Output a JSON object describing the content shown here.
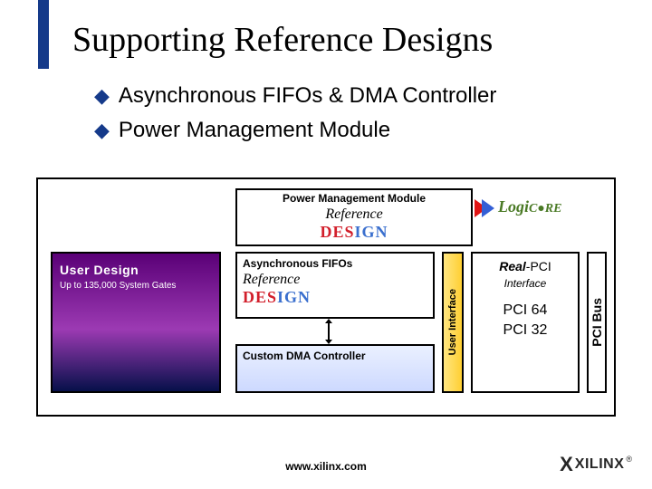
{
  "title": "Supporting Reference Designs",
  "bullets": {
    "b1": "Asynchronous FIFOs & DMA Controller",
    "b2": "Power Management Module"
  },
  "diagram": {
    "user_design": {
      "title": "User Design",
      "sub": "Up to 135,000 System Gates"
    },
    "pm_module": {
      "label": "Power Management Module"
    },
    "refdesign": {
      "line1": "Reference",
      "line2a": "DES",
      "line2b": "IGN"
    },
    "async": {
      "label": "Asynchronous FIFOs"
    },
    "custom_dma": {
      "label": "Custom DMA Controller"
    },
    "user_interface": {
      "label": "User Interface"
    },
    "real_pci": {
      "title_italic": "Real",
      "title_rest": "-PCI",
      "sub": "Interface",
      "pci64": "PCI 64",
      "pci32": "PCI 32"
    },
    "logicore": {
      "word": "Logi",
      "core": "C●RE"
    },
    "pci_bus": {
      "label": "PCI Bus"
    }
  },
  "footer": {
    "url": "www.xilinx.com",
    "brand": "XILINX",
    "reg": "®"
  }
}
